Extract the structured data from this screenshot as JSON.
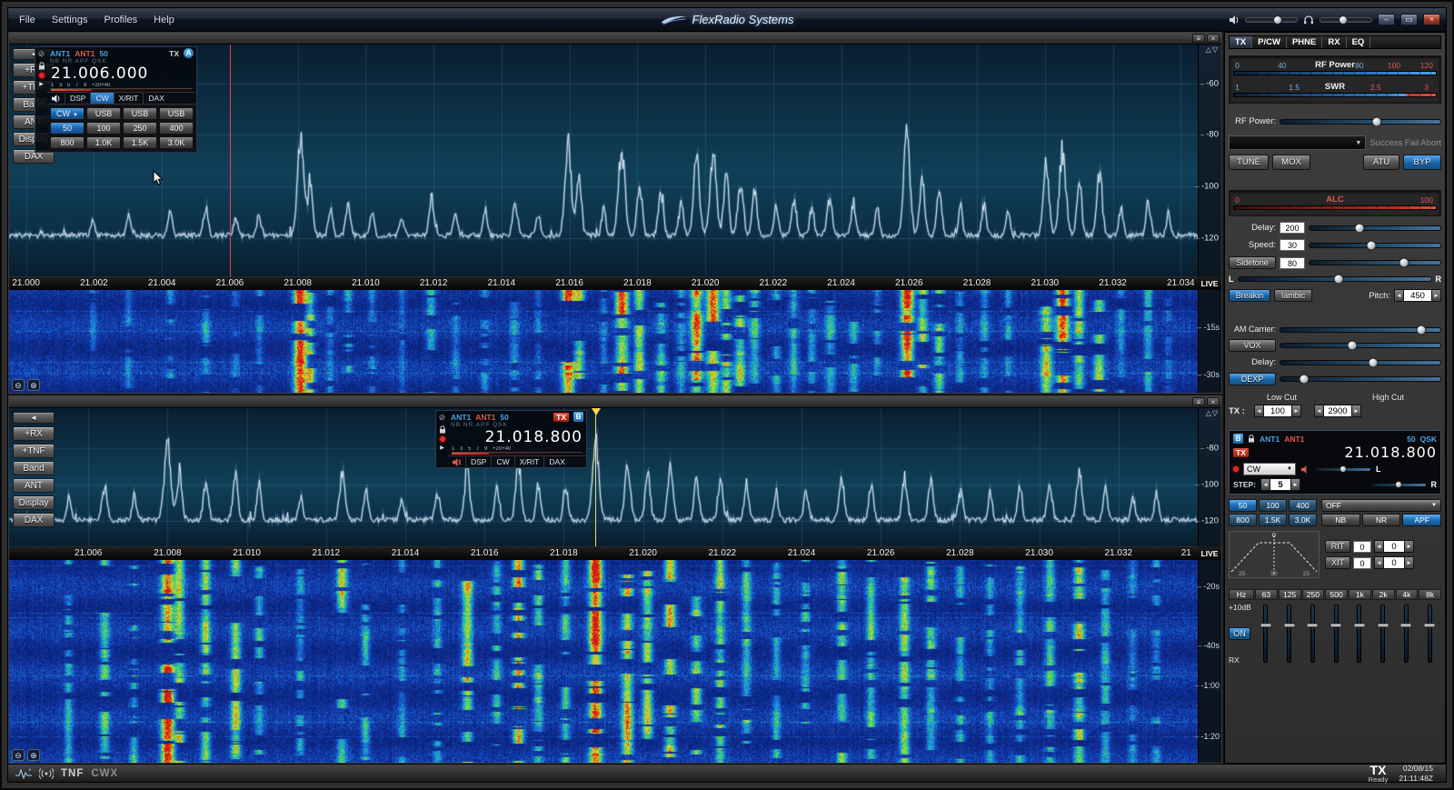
{
  "titlebar": {
    "menus": [
      "File",
      "Settings",
      "Profiles",
      "Help"
    ],
    "brand": "FlexRadio Systems"
  },
  "sidebar_buttons": [
    "+RX",
    "+TNF",
    "Band",
    "ANT",
    "Display",
    "DAX"
  ],
  "pan_a": {
    "slice": {
      "ant_rx": "ANT1",
      "ant_tx": "ANT1",
      "power": "50",
      "tx": "TX",
      "id": "A",
      "flags": "NB NR APF QSK",
      "frequency": "21.006.000",
      "meter_scale": "1 3 5 7 9 +20+40",
      "tabs": [
        "DSP",
        "CW",
        "X/RIT",
        "DAX"
      ],
      "active_tab": "CW",
      "mode_rows": [
        [
          "CW",
          "USB",
          "USB",
          "USB"
        ],
        [
          "50",
          "100",
          "250",
          "400"
        ],
        [
          "800",
          "1.0K",
          "1.5K",
          "3.0K"
        ]
      ],
      "active_filter": "50"
    },
    "freq_labels": [
      "21.000",
      "21.002",
      "21.004",
      "21.006",
      "21.008",
      "21.010",
      "21.012",
      "21.014",
      "21.016",
      "21.018",
      "21.020",
      "21.022",
      "21.024",
      "21.026",
      "21.028",
      "21.030",
      "21.032",
      "21.034"
    ],
    "db_labels": [
      "-60",
      "-80",
      "-100",
      "-120"
    ],
    "time_labels": [
      "-15s",
      "-30s"
    ],
    "live": "LIVE",
    "range": [
      20.9995,
      21.0345
    ],
    "marker": 21.006,
    "db_range": [
      -45,
      -135
    ]
  },
  "pan_b": {
    "slice": {
      "ant_rx": "ANT1",
      "ant_tx": "ANT1",
      "power": "50",
      "tx": "TX",
      "id": "B",
      "flags": "NB NR APF QSK",
      "frequency": "21.018.800",
      "meter_scale": "1 3 5 7 9 +20+40",
      "tabs": [
        "DSP",
        "CW",
        "X/RIT",
        "DAX"
      ],
      "active_tab": ""
    },
    "freq_labels": [
      "21.006",
      "21.008",
      "21.010",
      "21.012",
      "21.014",
      "21.016",
      "21.018",
      "21.020",
      "21.022",
      "21.024",
      "21.026",
      "21.028",
      "21.030",
      "21.032",
      "21"
    ],
    "db_labels": [
      "-80",
      "-100",
      "-120"
    ],
    "time_labels": [
      "-20s",
      "-40s",
      "-1:00",
      "-1:20"
    ],
    "live": "LIVE",
    "range": [
      21.004,
      21.034
    ],
    "marker": 21.0188,
    "db_range": [
      -58,
      -134
    ]
  },
  "right": {
    "tabs": [
      "TX",
      "P/CW",
      "PHNE",
      "RX",
      "EQ"
    ],
    "active_tab": "TX",
    "rf_meter": {
      "label": "RF Power",
      "ticks": [
        "0",
        "40",
        "80",
        "100",
        "120"
      ]
    },
    "swr_meter": {
      "label": "SWR",
      "ticks": [
        "1",
        "1.5",
        "2.5",
        "3"
      ]
    },
    "rf_power_label": "RF Power:",
    "atu_status": "Success Fail Abort",
    "tune": "TUNE",
    "mox": "MOX",
    "atu": "ATU",
    "byp": "BYP",
    "alc": {
      "label": "ALC",
      "ticks": [
        "0",
        "100"
      ]
    },
    "cw": {
      "delay_label": "Delay:",
      "delay": "200",
      "speed_label": "Speed:",
      "speed": "30",
      "sidetone": "Sidetone",
      "sidetone_val": "80",
      "left": "L",
      "right": "R",
      "breakin": "Breakin",
      "iambic": "Iambic",
      "pitch_label": "Pitch:",
      "pitch": "450"
    },
    "phone": {
      "am_carrier_label": "AM Carrier:",
      "vox": "VOX",
      "delay_label": "Delay:",
      "dexp": "DEXP",
      "low_cut": "Low Cut",
      "high_cut": "High Cut",
      "tx_label": "TX :",
      "low_cut_val": "100",
      "high_cut_val": "2900"
    },
    "slice": {
      "id": "B",
      "ant_rx": "ANT1",
      "ant_tx": "ANT1",
      "power": "50",
      "qsk": "QSK",
      "tx": "TX",
      "frequency": "21.018.800",
      "mode": "CW",
      "step_label": "STEP:",
      "step": "5",
      "left": "L",
      "right": "R",
      "filters": [
        "50",
        "100",
        "400",
        "800",
        "1.5K",
        "3.0K"
      ],
      "active_filter": "50",
      "agc": "OFF",
      "dsp": [
        "NB",
        "NR",
        "APF"
      ],
      "active_dsp": "APF",
      "rit": "RIT",
      "rit_val": "0",
      "rit_spin": "0",
      "xit": "XIT",
      "xit_val": "0",
      "xit_spin": "0",
      "agc_zero": "0",
      "agc_ticks": [
        "25",
        "50",
        "25"
      ]
    },
    "eq": {
      "hz": "Hz",
      "bands": [
        "63",
        "125",
        "250",
        "500",
        "1k",
        "2k",
        "4k",
        "8k"
      ],
      "db_label": "+10dB",
      "on": "ON",
      "mode": "RX"
    }
  },
  "statusbar": {
    "tnf": "TNF",
    "cwx": "CWX",
    "tx": "TX",
    "tx_state": "Ready",
    "date": "02/08/15",
    "time": "21:11:48Z"
  },
  "sliders": {
    "tb_volume": 62,
    "tb_phones": 45,
    "rf_power": 60,
    "delay": 38,
    "speed": 47,
    "sidetone": 72,
    "cw_monitor": 52,
    "am_carrier": 88,
    "vox": 45,
    "vox_delay": 58,
    "dexp": 15,
    "slice_l": 50,
    "slice_r": 50,
    "eq": [
      50,
      50,
      50,
      50,
      50,
      50,
      50,
      50
    ]
  }
}
